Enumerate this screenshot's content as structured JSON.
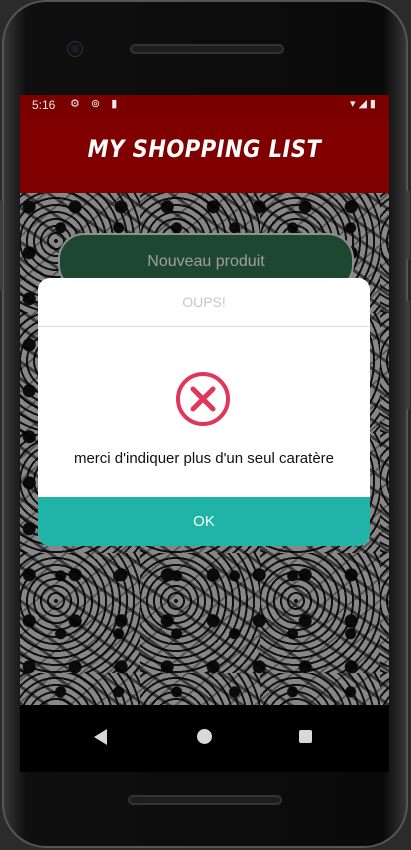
{
  "status_bar": {
    "time": "5:16",
    "left_icons": "⚙ ⊚ ▮",
    "right_icons": "▾◢▮"
  },
  "app_bar": {
    "title": "MY SHOPPING LIST"
  },
  "main": {
    "new_product_label": "Nouveau produit"
  },
  "dialog": {
    "title": "OUPS!",
    "message": "merci d'indiquer plus d'un seul caratère",
    "ok_label": "OK",
    "icon": "error-x-icon"
  },
  "colors": {
    "app_bar": "#800000",
    "status_bar": "#7a0000",
    "button_green": "#2f6e4c",
    "ok_teal": "#20b4a8",
    "error_red": "#e0365a"
  },
  "nav_bar": {
    "icons": [
      "back-icon",
      "home-icon",
      "recent-apps-icon"
    ]
  }
}
